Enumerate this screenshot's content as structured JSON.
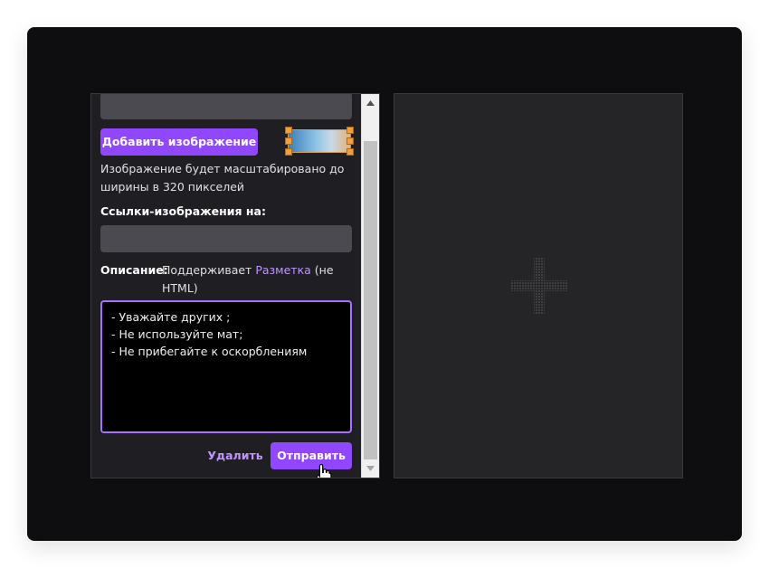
{
  "editor": {
    "add_image_label": "Добавить изображение",
    "scale_hint": "Изображение будет масштабировано до ширины в 320 пикселей",
    "links_label": "Ссылки-изображения на:",
    "links_input_value": "",
    "description": {
      "label": "Описание:",
      "prefix": "Поддерживает ",
      "link_text": "Разметка",
      "suffix": " (не HTML)",
      "lines": [
        "- Уважайте других ;",
        "- Не используйте мат;",
        "- Не прибегайте к оскорблениям"
      ]
    },
    "delete_label": "Удалить",
    "send_label": "Отправить"
  },
  "icons": {
    "scroll_up": "arrow-up-icon",
    "scroll_down": "arrow-down-icon",
    "plus": "plus-icon",
    "cursor": "hand-pointer-icon"
  },
  "colors": {
    "accent": "#9147ff",
    "accent_light": "#bf94ff",
    "panel": "#1f1f23",
    "frame": "#0e0e10"
  }
}
